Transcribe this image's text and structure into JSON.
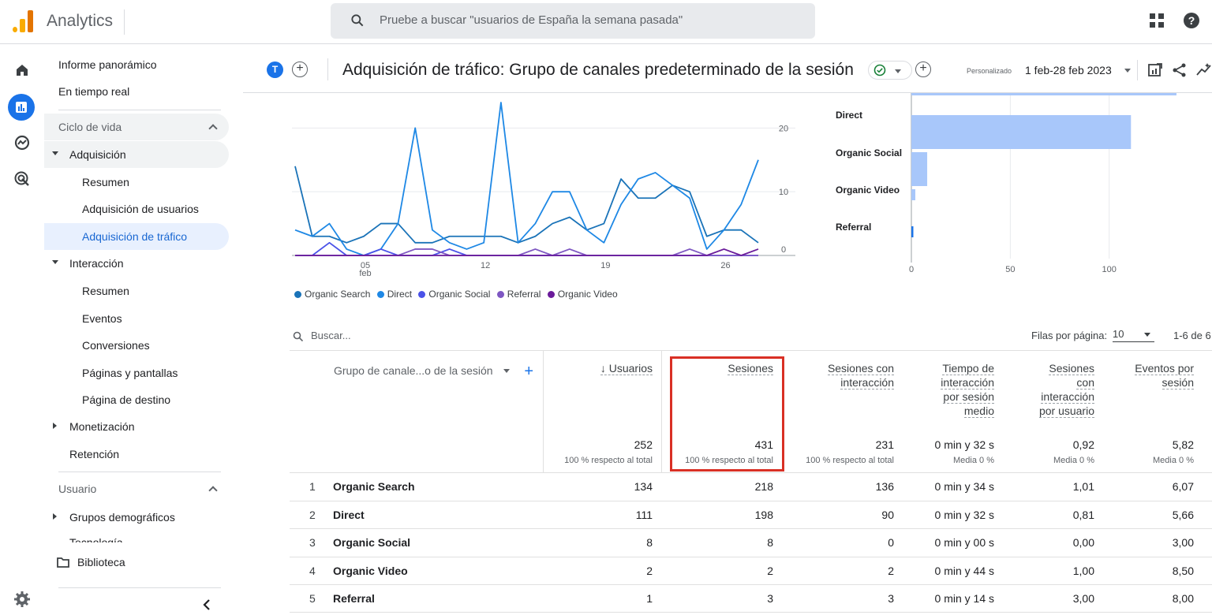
{
  "app": {
    "title": "Analytics"
  },
  "search": {
    "placeholder": "Pruebe a buscar \"usuarios de España la semana pasada\""
  },
  "sidebar": {
    "overview": "Informe panorámico",
    "realtime": "En tiempo real",
    "lifecycle_label": "Ciclo de vida",
    "acquisition": "Adquisición",
    "acq_items": [
      "Resumen",
      "Adquisición de usuarios",
      "Adquisición de tráfico"
    ],
    "engagement": "Interacción",
    "eng_items": [
      "Resumen",
      "Eventos",
      "Conversiones",
      "Páginas y pantallas",
      "Página de destino"
    ],
    "monetization": "Monetización",
    "retention": "Retención",
    "user_label": "Usuario",
    "demographics": "Grupos demográficos",
    "tech": "Tecnología",
    "library": "Biblioteca"
  },
  "header": {
    "avatar_letter": "T",
    "title": "Adquisición de tráfico: Grupo de canales predeterminado de la sesión",
    "custom_label": "Personalizado",
    "date_range": "1 feb-28 feb 2023"
  },
  "colors": {
    "organic_search": "#1a73b8",
    "direct": "#1e88e5",
    "organic_social": "#4a52e8",
    "referral": "#7e57c2",
    "organic_video": "#6a1b9a",
    "bar": "#a8c7fa",
    "highlight": "#d93025"
  },
  "chart_data": [
    {
      "type": "line",
      "x_tick_labels": [
        "05\nfeb",
        "12",
        "19",
        "26"
      ],
      "y_tick_labels": [
        "0",
        "10",
        "20"
      ],
      "ylim": [
        0,
        24
      ],
      "x": [
        1,
        2,
        3,
        4,
        5,
        6,
        7,
        8,
        9,
        10,
        11,
        12,
        13,
        14,
        15,
        16,
        17,
        18,
        19,
        20,
        21,
        22,
        23,
        24,
        25,
        26,
        27,
        28
      ],
      "series": [
        {
          "name": "Organic Search",
          "values": [
            14,
            3,
            3,
            2,
            3,
            5,
            5,
            2,
            2,
            3,
            3,
            3,
            3,
            2,
            3,
            5,
            6,
            4,
            5,
            12,
            9,
            9,
            11,
            10,
            3,
            4,
            4,
            2
          ]
        },
        {
          "name": "Direct",
          "values": [
            4,
            3,
            5,
            1,
            0,
            1,
            5,
            20,
            4,
            2,
            1,
            2,
            24,
            2,
            5,
            10,
            10,
            4,
            2,
            8,
            12,
            13,
            11,
            9,
            1,
            4,
            8,
            15
          ]
        },
        {
          "name": "Organic Social",
          "values": [
            0,
            0,
            2,
            0,
            0,
            1,
            0,
            0,
            0,
            1,
            0,
            0,
            0,
            0,
            0,
            0,
            0,
            0,
            0,
            0,
            0,
            0,
            0,
            0,
            0,
            0,
            0,
            0
          ]
        },
        {
          "name": "Referral",
          "values": [
            0,
            0,
            0,
            0,
            0,
            0,
            0,
            1,
            1,
            0,
            0,
            0,
            0,
            0,
            1,
            0,
            1,
            0,
            0,
            0,
            0,
            0,
            0,
            1,
            0,
            0,
            0,
            0
          ]
        },
        {
          "name": "Organic Video",
          "values": [
            0,
            0,
            0,
            0,
            0,
            0,
            0,
            0,
            0,
            0,
            0,
            0,
            0,
            0,
            0,
            0,
            0,
            0,
            0,
            0,
            0,
            0,
            0,
            0,
            0,
            1,
            0,
            1
          ]
        }
      ]
    },
    {
      "type": "bar",
      "orientation": "horizontal",
      "categories": [
        "Organic Search",
        "Direct",
        "Organic Social",
        "Organic Video",
        "Referral"
      ],
      "visible_category_labels": [
        "Direct",
        "Organic Social",
        "Organic Video",
        "Referral"
      ],
      "values": [
        134,
        111,
        8,
        2,
        1
      ],
      "x_tick_labels": [
        "0",
        "50",
        "100"
      ],
      "xlim": [
        0,
        140
      ]
    }
  ],
  "table": {
    "search_placeholder": "Buscar...",
    "rows_per_page_label": "Filas por página:",
    "rows_per_page": "10",
    "paging": "1-6 de 6",
    "dimension_header": "Grupo de canale...o de la sesión",
    "add_dimension": "+",
    "columns": [
      {
        "label": "↓ Usuarios",
        "total": "252",
        "sub": "100 % respecto al total"
      },
      {
        "label": "Sesiones",
        "total": "431",
        "sub": "100 % respecto al total"
      },
      {
        "label": "Sesiones con\ninteracción",
        "total": "231",
        "sub": "100 % respecto al total"
      },
      {
        "label": "Tiempo de\ninteracción\npor sesión\nmedio",
        "total": "0 min y 32 s",
        "sub": "Media 0 %"
      },
      {
        "label": "Sesiones\ncon\ninteracción\npor usuario",
        "total": "0,92",
        "sub": "Media 0 %"
      },
      {
        "label": "Eventos por\nsesión",
        "total": "5,82",
        "sub": "Media 0 %"
      }
    ],
    "rows": [
      {
        "rank": "1",
        "name": "Organic Search",
        "values": [
          "134",
          "218",
          "136",
          "0 min y 34 s",
          "1,01",
          "6,07"
        ]
      },
      {
        "rank": "2",
        "name": "Direct",
        "values": [
          "111",
          "198",
          "90",
          "0 min y 32 s",
          "0,81",
          "5,66"
        ]
      },
      {
        "rank": "3",
        "name": "Organic Social",
        "values": [
          "8",
          "8",
          "0",
          "0 min y 00 s",
          "0,00",
          "3,00"
        ]
      },
      {
        "rank": "4",
        "name": "Organic Video",
        "values": [
          "2",
          "2",
          "2",
          "0 min y 44 s",
          "1,00",
          "8,50"
        ]
      },
      {
        "rank": "5",
        "name": "Referral",
        "values": [
          "1",
          "3",
          "3",
          "0 min y 14 s",
          "3,00",
          "8,00"
        ]
      }
    ]
  }
}
